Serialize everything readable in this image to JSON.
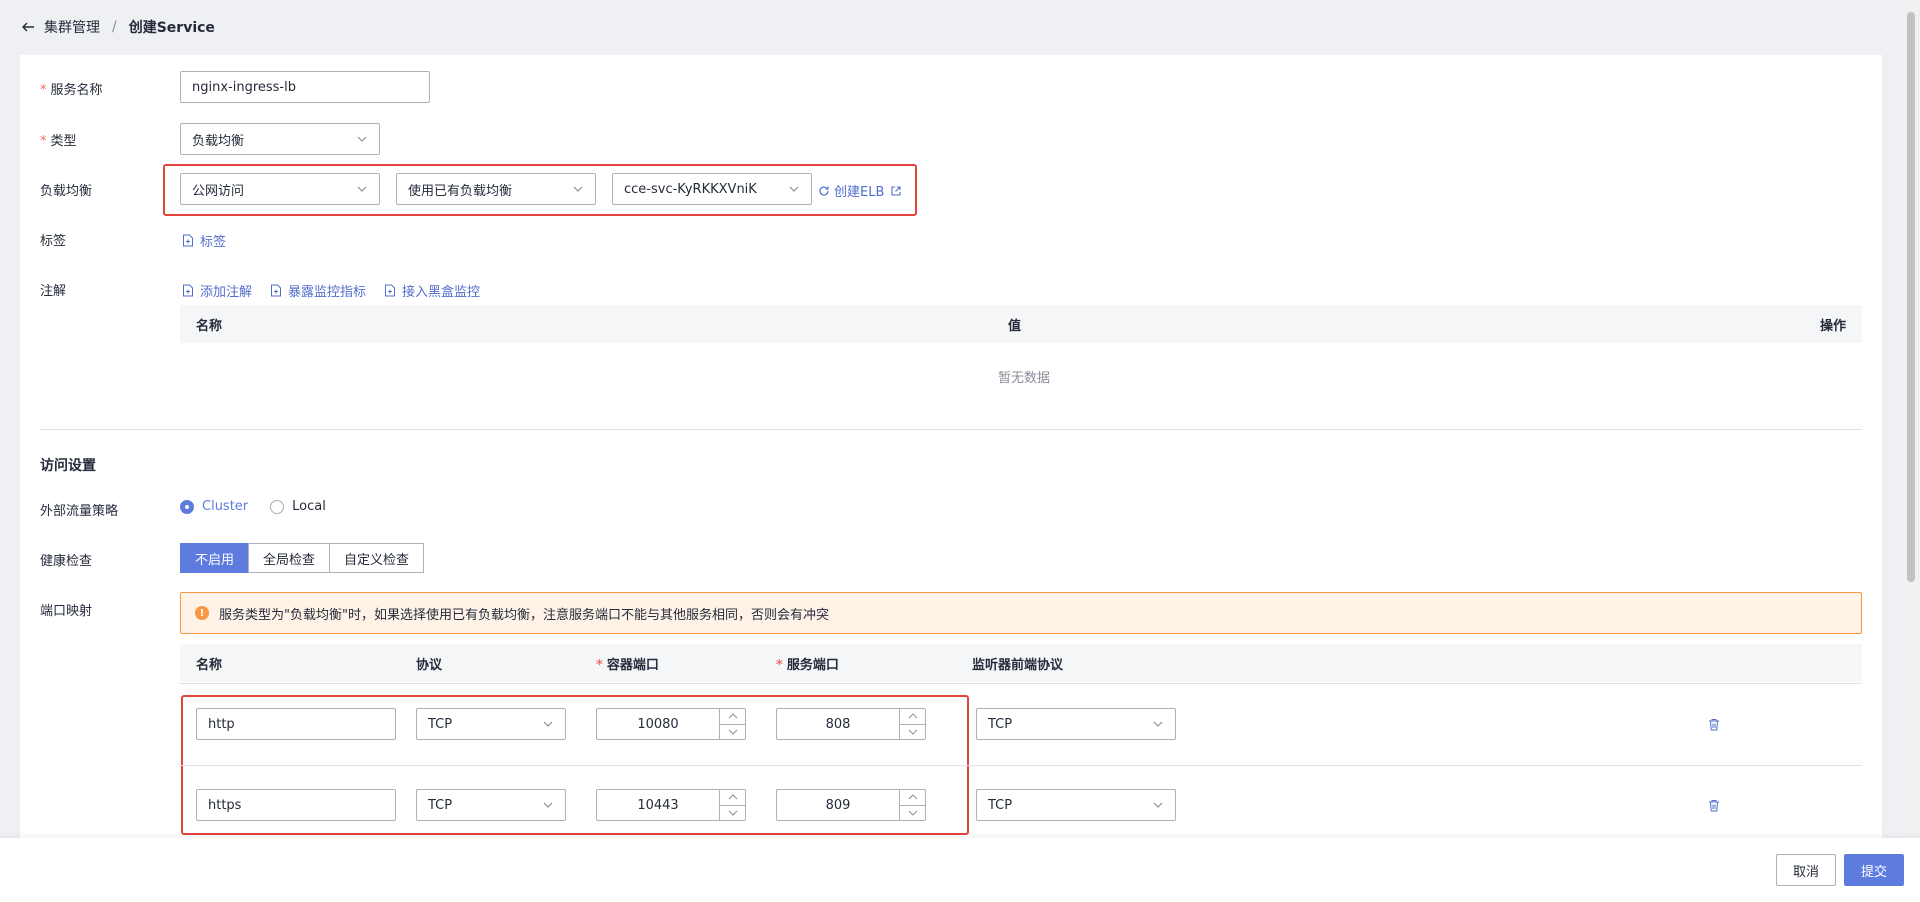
{
  "breadcrumb": {
    "parent": "集群管理",
    "separator": "/",
    "current": "创建Service"
  },
  "form": {
    "service_name": {
      "label": "服务名称",
      "value": "nginx-ingress-lb"
    },
    "type": {
      "label": "类型",
      "value": "负载均衡"
    },
    "load_balancer": {
      "label": "负载均衡",
      "access": "公网访问",
      "mode": "使用已有负载均衡",
      "instance": "cce-svc-KyRKKXVniK",
      "create_link": "创建ELB"
    },
    "tags": {
      "label": "标签",
      "add_link": "标签"
    },
    "annotations": {
      "label": "注解",
      "actions": [
        "添加注解",
        "暴露监控指标",
        "接入黑盒监控"
      ],
      "columns": [
        "名称",
        "值",
        "操作"
      ],
      "empty": "暂无数据"
    }
  },
  "access": {
    "section_title": "访问设置",
    "traffic_policy": {
      "label": "外部流量策略",
      "options": [
        "Cluster",
        "Local"
      ],
      "selected": "Cluster"
    },
    "health_check": {
      "label": "健康检查",
      "options": [
        "不启用",
        "全局检查",
        "自定义检查"
      ],
      "selected": "不启用"
    },
    "port_mapping": {
      "label": "端口映射",
      "alert": "服务类型为\"负载均衡\"时，如果选择使用已有负载均衡，注意服务端口不能与其他服务相同，否则会有冲突",
      "columns": {
        "name": "名称",
        "protocol": "协议",
        "container_port": "容器端口",
        "service_port": "服务端口",
        "listener_protocol": "监听器前端协议"
      },
      "rows": [
        {
          "name": "http",
          "protocol": "TCP",
          "container_port": "10080",
          "service_port": "808",
          "listener_protocol": "TCP"
        },
        {
          "name": "https",
          "protocol": "TCP",
          "container_port": "10443",
          "service_port": "809",
          "listener_protocol": "TCP"
        }
      ]
    }
  },
  "footer": {
    "cancel": "取消",
    "submit": "提交"
  },
  "colors": {
    "primary": "#5e7ce0",
    "highlight": "#e0443a",
    "warning": "#fa9841"
  }
}
